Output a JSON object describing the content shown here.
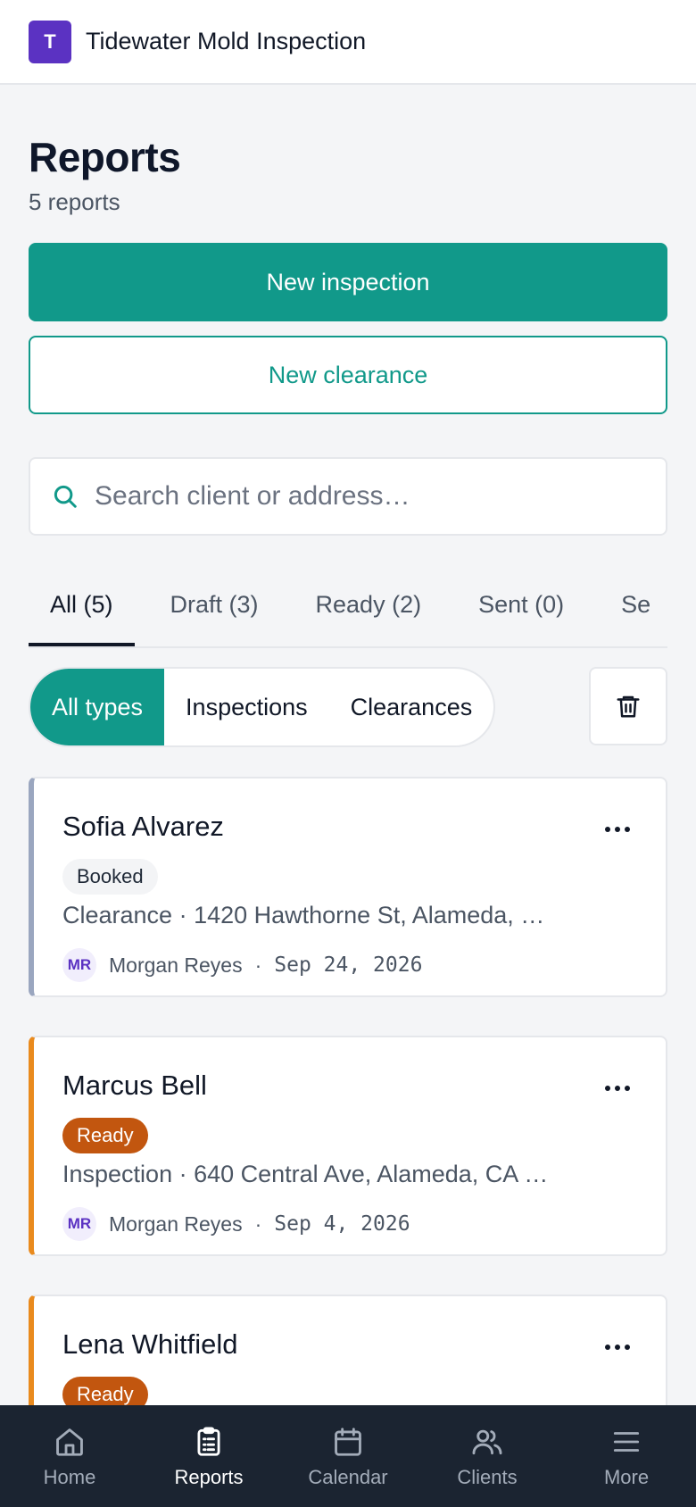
{
  "app": {
    "logo_letter": "T",
    "title": "Tidewater Mold Inspection"
  },
  "page": {
    "title": "Reports",
    "count": "5 reports"
  },
  "actions": {
    "new_inspection": "New inspection",
    "new_clearance": "New clearance"
  },
  "search": {
    "placeholder": "Search client or address…",
    "value": ""
  },
  "tabs": [
    {
      "label": "All (5)",
      "active": true
    },
    {
      "label": "Draft (3)",
      "active": false
    },
    {
      "label": "Ready (2)",
      "active": false
    },
    {
      "label": "Sent (0)",
      "active": false
    },
    {
      "label": "Se",
      "active": false
    }
  ],
  "type_filter": {
    "options": [
      "All types",
      "Inspections",
      "Clearances"
    ],
    "selected": "All types"
  },
  "reports": [
    {
      "name": "Sofia Alvarez",
      "status": "Booked",
      "summary": "Clearance · 1420 Hawthorne St, Alameda, …",
      "author_initials": "MR",
      "author": "Morgan Reyes",
      "separator": "·",
      "date": "Sep 24, 2026"
    },
    {
      "name": "Marcus Bell",
      "status": "Ready",
      "summary": "Inspection · 640 Central Ave, Alameda, CA …",
      "author_initials": "MR",
      "author": "Morgan Reyes",
      "separator": "·",
      "date": "Sep 4, 2026"
    },
    {
      "name": "Lena Whitfield",
      "status": "Ready",
      "summary": "",
      "author_initials": "",
      "author": "",
      "separator": "",
      "date": ""
    }
  ],
  "nav": [
    {
      "label": "Home",
      "icon": "home-icon",
      "active": false
    },
    {
      "label": "Reports",
      "icon": "clipboard-icon",
      "active": true
    },
    {
      "label": "Calendar",
      "icon": "calendar-icon",
      "active": false
    },
    {
      "label": "Clients",
      "icon": "users-icon",
      "active": false
    },
    {
      "label": "More",
      "icon": "menu-icon",
      "active": false
    }
  ],
  "colors": {
    "brand": "#5b32c2",
    "accent": "#11998a",
    "ready": "#c2560f",
    "nav_bg": "#1b2431"
  }
}
